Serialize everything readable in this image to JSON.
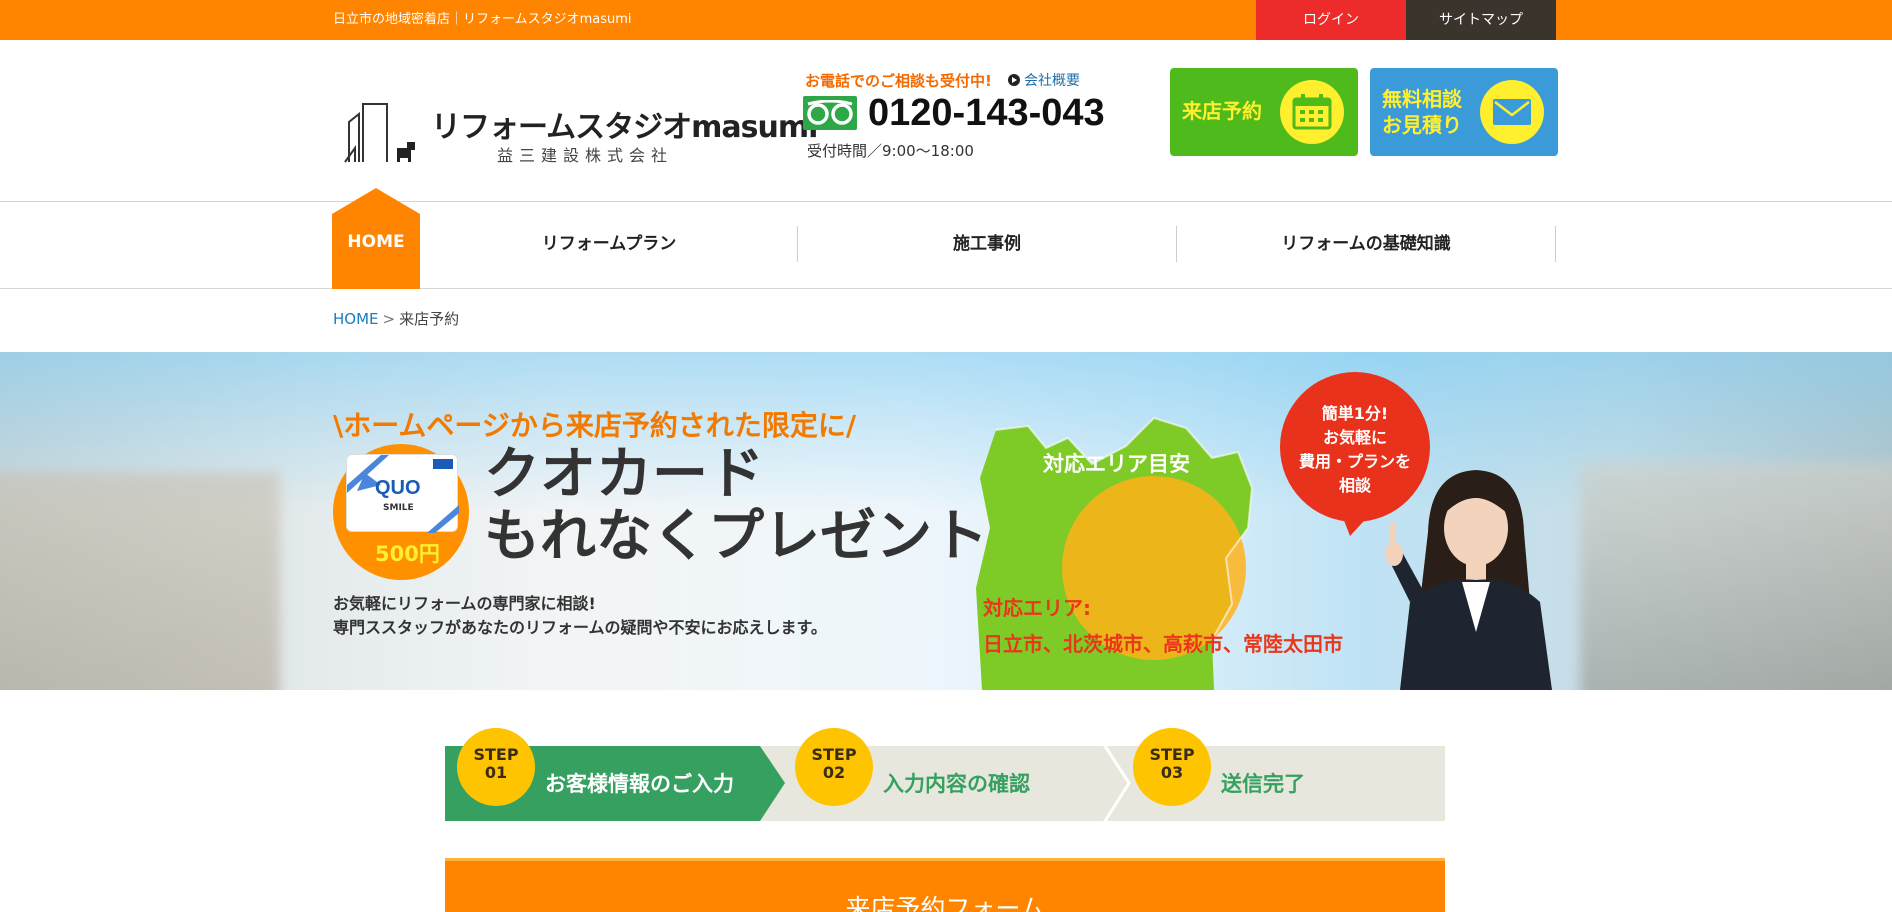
{
  "topbar": {
    "tagline": "日立市の地域密着店｜リフォームスタジオmasumi",
    "login": "ログイン",
    "sitemap": "サイトマップ"
  },
  "logo": {
    "main": "リフォームスタジオmasumi",
    "sub": "益三建設株式会社"
  },
  "contact": {
    "note": "お電話でのご相談も受付中!",
    "company_link": "会社概要",
    "tel": "0120-143-043",
    "hours": "受付時間／9:00〜18:00"
  },
  "cta": {
    "visit": "来店予約",
    "estimate": "無料相談\nお見積り"
  },
  "nav": {
    "home": "HOME",
    "items": [
      "リフォームプラン",
      "施工事例",
      "リフォームの基礎知識"
    ]
  },
  "breadcrumb": {
    "home": "HOME",
    "separator": ">",
    "current": "来店予約"
  },
  "hero": {
    "headline": "\\ホームページから来店予約された限定に/",
    "quo_logo": "QUO",
    "quo_smile": "SMILE",
    "quo_amount": "500円",
    "title": "クオカード\nもれなくプレゼント",
    "desc": "お気軽にリフォームの専門家に相談!\n専門ススタッフがあなたのリフォームの疑問や不安にお応えします。",
    "map_label": "対応エリア目安",
    "area_title": "対応エリア:",
    "area_list": "日立市、北茨城市、高萩市、常陸太田市",
    "bubble": "簡単1分!\nお気軽に\n費用・プランを\n相談"
  },
  "steps": [
    {
      "word": "STEP",
      "num": "01",
      "label": "お客様情報のご入力",
      "active": true
    },
    {
      "word": "STEP",
      "num": "02",
      "label": "入力内容の確認",
      "active": false
    },
    {
      "word": "STEP",
      "num": "03",
      "label": "送信完了",
      "active": false
    }
  ],
  "form": {
    "title": "来店予約フォーム"
  },
  "colors": {
    "accent": "#ff8400",
    "step_active": "#35a060",
    "step_circle": "#ffc400",
    "area_text": "#e8371b"
  }
}
